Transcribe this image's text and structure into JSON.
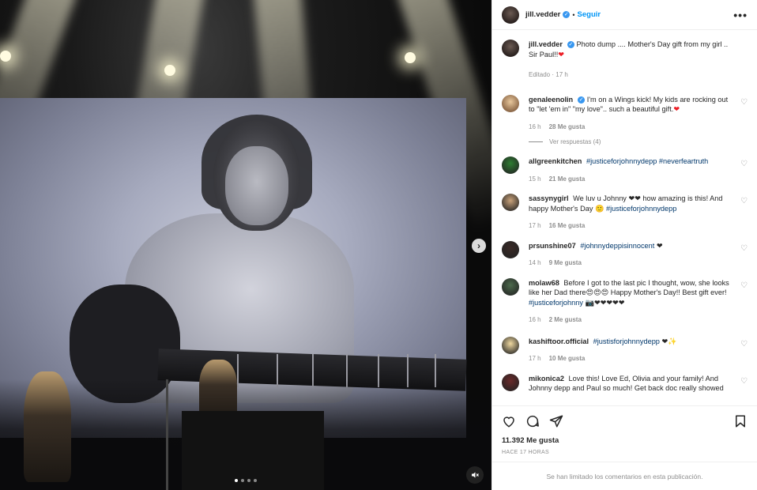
{
  "post": {
    "author": "jill.vedder",
    "follow_label": "Seguir",
    "separator": "•",
    "more_label": "•••",
    "caption": "Photo dump .... Mother's Day gift from my girl .. Sir Paul!!",
    "caption_emoji": "❤",
    "edited": "Editado · 17 h",
    "likes": "11.392 Me gusta",
    "time_ago": "HACE 17 HORAS",
    "comments_limited": "Se han limitado los comentarios en esta publicación.",
    "carousel_dots": 4,
    "active_dot": 0
  },
  "comments": [
    {
      "user": "genaleenolin",
      "verified": true,
      "text": "I'm on a Wings kick! My kids are rocking out to \"let 'em in\" \"my love\".. such a beautiful gift.",
      "emoji": "❤",
      "time": "16 h",
      "likes": "28 Me gusta",
      "replies": "Ver respuestas (4)"
    },
    {
      "user": "allgreenkitchen",
      "text": "#justiceforjohnnydepp #neverfeartruth",
      "time": "15 h",
      "likes": "21 Me gusta"
    },
    {
      "user": "sassynygirl",
      "text": "We luv u Johnny ❤❤ how amazing is this! And happy Mother's Day 🙂 #justiceforjohnnydepp",
      "time": "17 h",
      "likes": "16 Me gusta"
    },
    {
      "user": "prsunshine07",
      "text": "#johnnydeppisinnocent ❤",
      "time": "14 h",
      "likes": "9 Me gusta"
    },
    {
      "user": "molaw68",
      "text": "Before I got to the last pic I thought, wow, she looks like her Dad there😍😍😍 Happy Mother's Day!! Best gift ever! #justiceforjohnny 📷❤❤❤❤❤",
      "time": "16 h",
      "likes": "2 Me gusta"
    },
    {
      "user": "kashiftoor.official",
      "text": "#justisforjohnnydepp ❤✨",
      "time": "17 h",
      "likes": "10 Me gusta"
    },
    {
      "user": "mikonica2",
      "text": "Love this! Love Ed, Olivia and your family! And Johnny depp and Paul so much! Get back doc really showed"
    }
  ],
  "colors": {
    "link": "#0095f6",
    "hashtag": "#00376b",
    "muted": "#8e8e8e",
    "heart": "#ed1c24"
  }
}
